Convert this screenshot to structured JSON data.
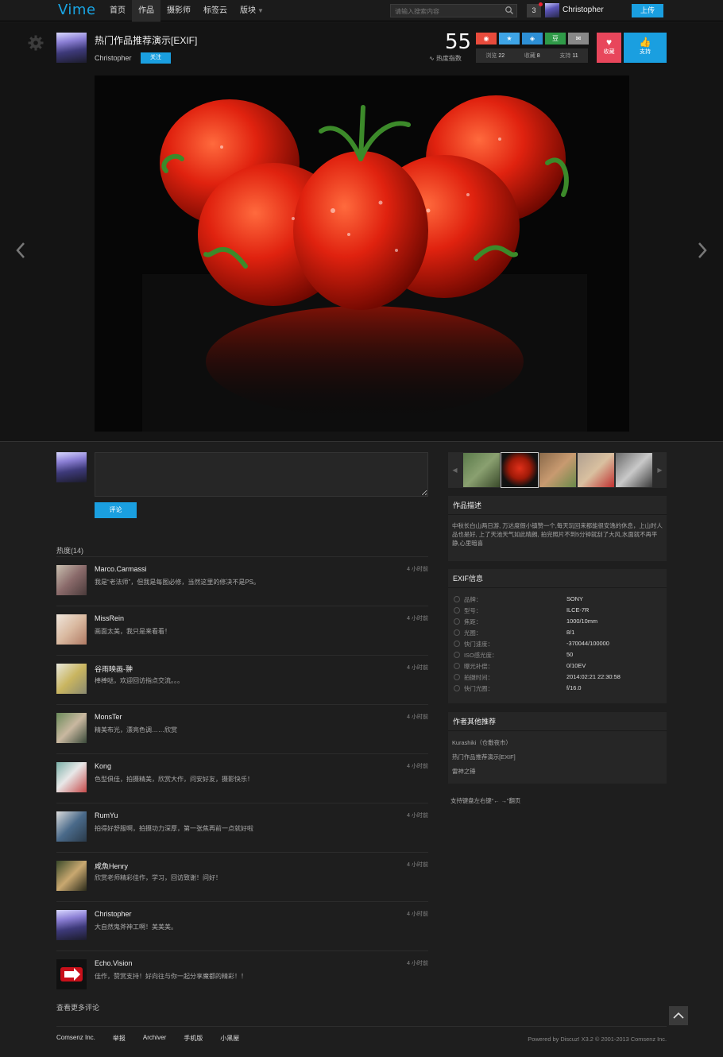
{
  "nav": {
    "logo": "Vime",
    "items": [
      "首页",
      "作品",
      "摄影师",
      "标签云",
      "版块"
    ],
    "search_placeholder": "请输入搜索内容",
    "notification_count": "3",
    "user_name": "Christopher",
    "upload_label": "上传"
  },
  "work": {
    "title": "热门作品推荐演示[EXIF]",
    "author": "Christopher",
    "follow_label": "关注",
    "heat_index": "55",
    "heat_label": "热度指数",
    "share_icons": [
      "weibo-icon",
      "star-icon",
      "qzone-icon",
      "douban-icon",
      "email-icon"
    ],
    "stats": {
      "views_label": "浏览",
      "views": "22",
      "favs_label": "收藏",
      "favs": "8",
      "support_label": "支持",
      "support": "11"
    },
    "fav_label": "收藏",
    "support_label": "支持"
  },
  "comment_form": {
    "submit_label": "评论"
  },
  "comments_header": "热度(14)",
  "comments": [
    {
      "name": "Marco.Carmassi",
      "time": "4 小时前",
      "text": "我是“老法师”，但我是每图必修，当然这里的修决不是PS。"
    },
    {
      "name": "MissRein",
      "time": "4 小时前",
      "text": "画面太美，我只是来看看！"
    },
    {
      "name": "谷雨映画-翀",
      "time": "4 小时前",
      "text": "棒棒哒，欢迎回访指点交流。。。"
    },
    {
      "name": "MonsTer",
      "time": "4 小时前",
      "text": "精美布光，漂亮色调……欣赏"
    },
    {
      "name": "Kong",
      "time": "4 小时前",
      "text": "色型俱佳，拍摄精美，欣赏大作，问安好友，摄影快乐！"
    },
    {
      "name": "RumYu",
      "time": "4 小时前",
      "text": "拍得好舒服啊，拍摄功力深厚，第一张焦再前一点就好啦"
    },
    {
      "name": "咸魚Henry",
      "time": "4 小时前",
      "text": "欣赏老师精彩佳作，学习，回访致谢！问好！"
    },
    {
      "name": "Christopher",
      "time": "4 小时前",
      "text": "大自然鬼斧神工啊！美美美。"
    },
    {
      "name": "Echo.Vision",
      "time": "4 小时前",
      "text": "佳作，赞赏支持！好向往与你一起分享魔都的精彩！！"
    }
  ],
  "more_comments": "查看更多评论",
  "description": {
    "title": "作品描述",
    "text": "中秋长白山两日游, 万达度假小镇赞一个,每天玩回来都能很安逸的休息，上山时人品也是好, 上了天池天气如此晴朗, 拍完照片不到5分钟就刮了大风,水面就不再平静,心里暗喜"
  },
  "exif": {
    "title": "EXIF信息",
    "rows": [
      {
        "label": "品牌：",
        "value": "SONY"
      },
      {
        "label": "型号：",
        "value": "ILCE-7R"
      },
      {
        "label": "焦距：",
        "value": "1000/10mm"
      },
      {
        "label": "光圈：",
        "value": "8/1"
      },
      {
        "label": "快门速度：",
        "value": "-370044/100000"
      },
      {
        "label": "ISO感光度：",
        "value": "50"
      },
      {
        "label": "曝光补偿：",
        "value": "0/10EV"
      },
      {
        "label": "拍摄时间：",
        "value": "2014:02:21 22:30:58"
      },
      {
        "label": "快门光圈：",
        "value": "f/16.0"
      }
    ]
  },
  "other_works": {
    "title": "作者其他推荐",
    "items": [
      "Kurashiki（仓敷夜市）",
      "热门作品推荐演示[EXIF]",
      "雷神之锤"
    ]
  },
  "keyboard_hint": "支持键盘左右键“← →”翻页",
  "footer": {
    "links": [
      "Comsenz Inc.",
      "举报",
      "Archiver",
      "手机版",
      "小黑屋"
    ],
    "powered": "Powered by Discuz! X3.2 © 2001-2013  Comsenz Inc."
  },
  "colors": {
    "accent": "#1a9fe0",
    "favorite": "#e8465b",
    "background": "#1e1e1e"
  }
}
